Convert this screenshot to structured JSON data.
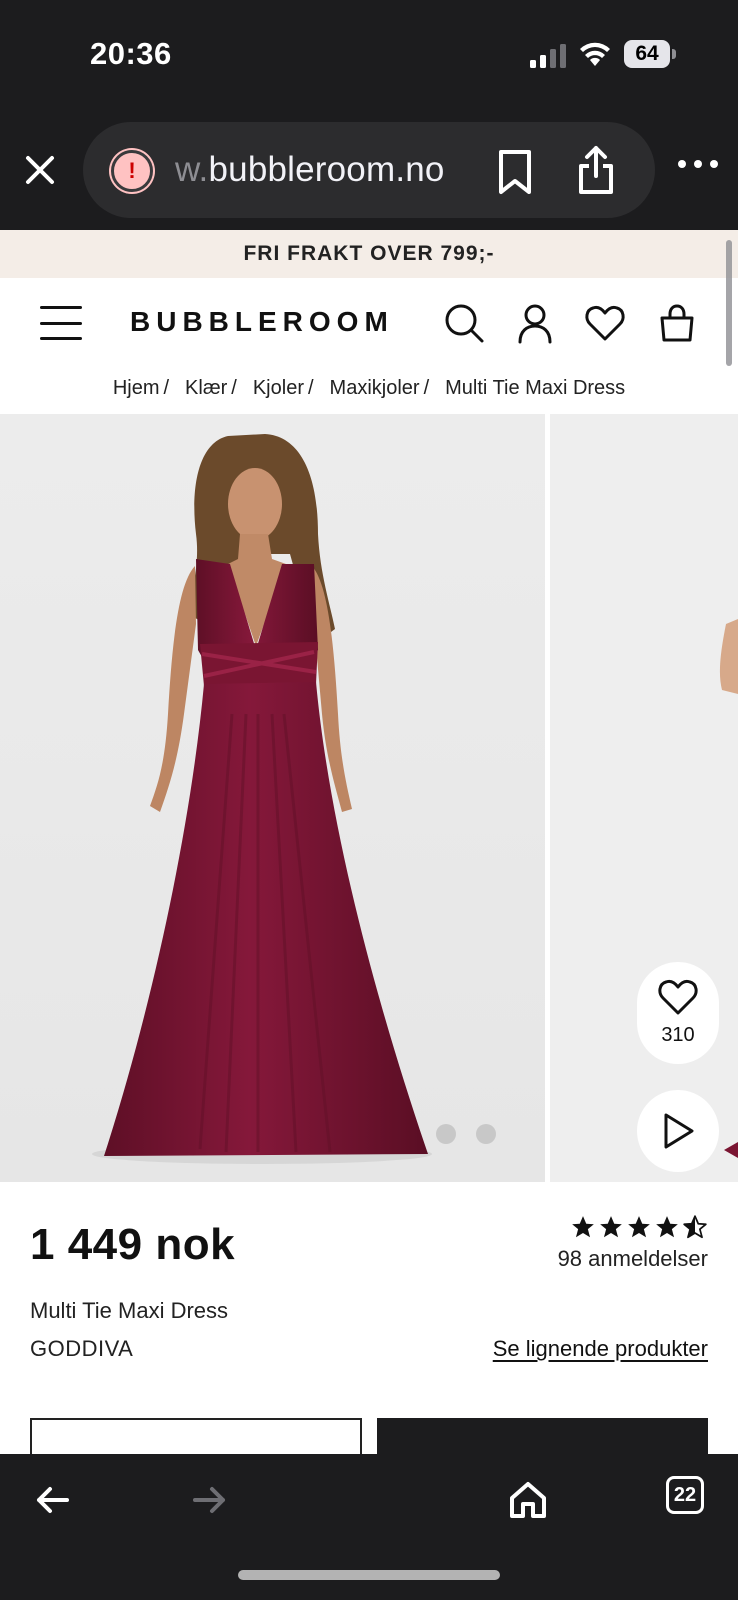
{
  "status_bar": {
    "time": "20:36",
    "battery": "64",
    "signal_icon": "cellular-signal-icon",
    "wifi_icon": "wifi-icon"
  },
  "browser": {
    "url_prefix": "w.",
    "url_main": "bubbleroom.no",
    "icons": [
      "close-icon",
      "warning-icon",
      "bookmark-icon",
      "share-icon",
      "more-icon"
    ]
  },
  "site": {
    "promo": "FRI FRAKT OVER 799;-",
    "logo": "BUBBLEROOM",
    "header_icons": [
      "menu-icon",
      "search-icon",
      "account-icon",
      "heart-icon",
      "bag-icon"
    ]
  },
  "breadcrumb": [
    {
      "label": "Hjem",
      "sep": "/"
    },
    {
      "label": "Klær",
      "sep": "/"
    },
    {
      "label": "Kjoler",
      "sep": "/"
    },
    {
      "label": "Maxikjoler",
      "sep": "/"
    },
    {
      "label": "Multi Tie Maxi Dress",
      "sep": ""
    }
  ],
  "gallery": {
    "favorites_count": "310",
    "dress_color": "#7a1532",
    "image_dots": 2
  },
  "product": {
    "price": "1 449 nok",
    "rating": 4.5,
    "reviews": "98 anmeldelser",
    "name": "Multi Tie Maxi Dress",
    "brand": "GODDIVA",
    "similar_link": "Se lignende produkter"
  },
  "toolbar": {
    "tabs_count": "22",
    "icons": [
      "back-arrow-icon",
      "forward-arrow-icon",
      "home-icon",
      "tabs-icon"
    ]
  }
}
